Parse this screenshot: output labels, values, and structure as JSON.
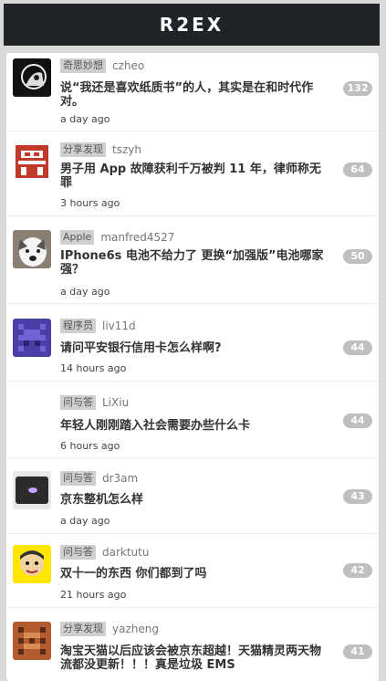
{
  "header": {
    "title": "R2EX"
  },
  "topics": [
    {
      "node": "奇思妙想",
      "user": "czheo",
      "title": "说“我还是喜欢纸质书”的人，其实是在和时代作对。",
      "time": "a day ago",
      "replies": "132",
      "avatar_icon": "avatar-czheo"
    },
    {
      "node": "分享发现",
      "user": "tszyh",
      "title": "男子用 App 故障获利千万被判 11 年，律师称无罪",
      "time": "3 hours ago",
      "replies": "64",
      "avatar_icon": "avatar-tszyh"
    },
    {
      "node": "Apple",
      "user": "manfred4527",
      "title": "IPhone6s 电池不给力了 更换“加强版”电池哪家强？",
      "time": "a day ago",
      "replies": "50",
      "avatar_icon": "avatar-manfred4527"
    },
    {
      "node": "程序员",
      "user": "liv11d",
      "title": "请问平安银行信用卡怎么样啊?",
      "time": "14 hours ago",
      "replies": "44",
      "avatar_icon": "avatar-liv11d"
    },
    {
      "node": "问与答",
      "user": "LiXiu",
      "title": "年轻人刚刚踏入社会需要办些什么卡",
      "time": "6 hours ago",
      "replies": "44",
      "avatar_icon": "avatar-lixiu"
    },
    {
      "node": "问与答",
      "user": "dr3am",
      "title": "京东整机怎么样",
      "time": "a day ago",
      "replies": "43",
      "avatar_icon": "avatar-dr3am"
    },
    {
      "node": "问与答",
      "user": "darktutu",
      "title": "双十一的东西 你们都到了吗",
      "time": "21 hours ago",
      "replies": "42",
      "avatar_icon": "avatar-darktutu"
    },
    {
      "node": "分享发现",
      "user": "yazheng",
      "title": "淘宝天猫以后应该会被京东超越！天猫精灵两天物流都没更新！！！真是垃圾 EMS",
      "time": "",
      "replies": "41",
      "avatar_icon": "avatar-yazheng"
    }
  ]
}
